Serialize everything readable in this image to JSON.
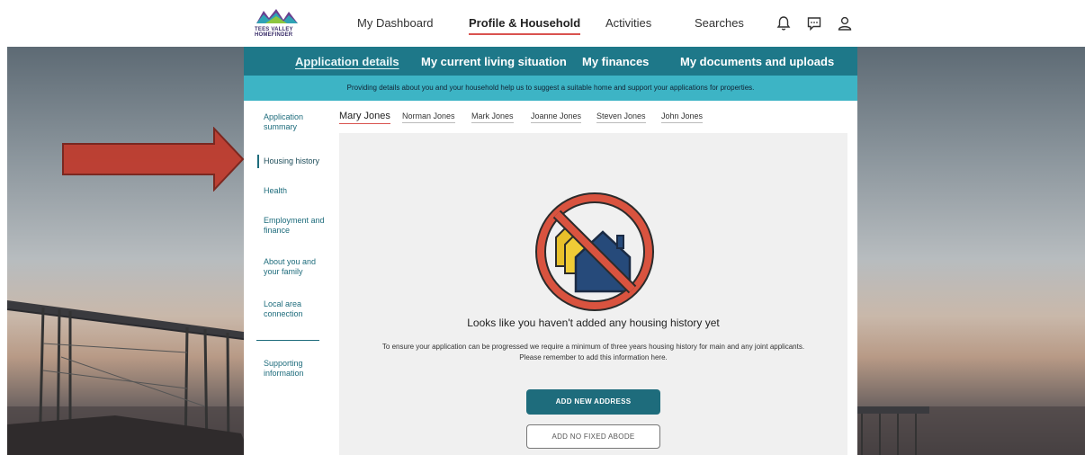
{
  "brand": {
    "logo_line1": "TEES VALLEY",
    "logo_line2": "HOMEFINDER",
    "colors": {
      "teal": "#1e7889",
      "light_teal": "#3db4c5",
      "accent_red": "#d9534f"
    }
  },
  "topnav": {
    "items": [
      {
        "label": "My Dashboard"
      },
      {
        "label": "Profile & Household",
        "active": true
      },
      {
        "label": "Activities"
      },
      {
        "label": "Searches"
      }
    ],
    "icons": [
      "bell-icon",
      "chat-icon",
      "user-icon"
    ]
  },
  "tabs": {
    "items": [
      {
        "label": "Application details",
        "active": true
      },
      {
        "label": "My current living situation"
      },
      {
        "label": "My finances"
      },
      {
        "label": "My documents and uploads"
      }
    ],
    "info_text": "Providing details about you and your household help us to suggest a suitable home and support your applications for properties."
  },
  "sidebar": {
    "items": [
      {
        "label": "Application summary"
      },
      {
        "label": "Housing history",
        "active": true
      },
      {
        "label": "Health"
      },
      {
        "label": "Employment and finance"
      },
      {
        "label": "About you and your family"
      },
      {
        "label": "Local area connection"
      },
      {
        "label": "Supporting information"
      }
    ]
  },
  "household": {
    "members": [
      "Mary Jones",
      "Norman Jones",
      "Mark Jones",
      "Joanne Jones",
      "Steven Jones",
      "John Jones"
    ],
    "selected": "Mary Jones"
  },
  "empty_state": {
    "title": "Looks like you haven't added any housing history yet",
    "line1": "To ensure your application can be progressed we require a minimum of three years housing history for main and any joint applicants.",
    "line2": "Please remember to add this information here.",
    "primary_button": "ADD NEW ADDRESS",
    "secondary_button": "ADD NO FIXED ABODE",
    "illustration": "no-housing-icon"
  },
  "annotation": {
    "arrow": "red-arrow-pointer"
  }
}
